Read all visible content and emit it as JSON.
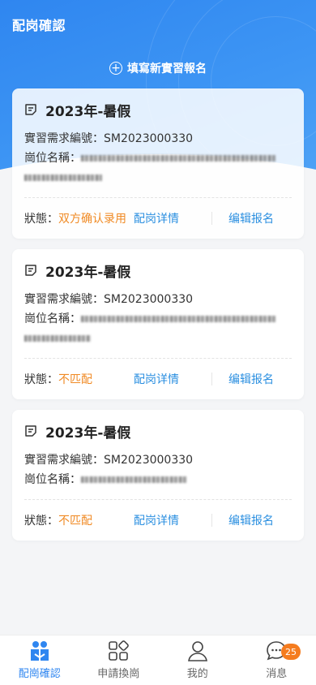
{
  "header": {
    "title": "配岗確認",
    "new_apply_label": "填寫新實習報名"
  },
  "cards": [
    {
      "term": "2023年-暑假",
      "req_label": "實習需求編號：",
      "req_no": "SM2023000330",
      "post_label": "崗位名稱：",
      "status_label": "狀態：",
      "status_value": "双方确认录用",
      "detail_label": "配岗详情",
      "edit_label": "编辑报名"
    },
    {
      "term": "2023年-暑假",
      "req_label": "實習需求編號：",
      "req_no": "SM2023000330",
      "post_label": "崗位名稱：",
      "status_label": "狀態：",
      "status_value": "不匹配",
      "detail_label": "配岗详情",
      "edit_label": "编辑报名"
    },
    {
      "term": "2023年-暑假",
      "req_label": "實習需求編號：",
      "req_no": "SM2023000330",
      "post_label": "崗位名稱：",
      "status_label": "狀態：",
      "status_value": "不匹配",
      "detail_label": "配岗详情",
      "edit_label": "编辑报名"
    }
  ],
  "tabbar": {
    "items": [
      {
        "label": "配崗確認",
        "icon": "people-icon",
        "active": true
      },
      {
        "label": "申請換崗",
        "icon": "apps-icon",
        "active": false
      },
      {
        "label": "我的",
        "icon": "user-icon",
        "active": false
      },
      {
        "label": "消息",
        "icon": "chat-icon",
        "active": false,
        "badge": "25"
      }
    ]
  },
  "colors": {
    "primary": "#2f86f0",
    "status_orange": "#f08a24",
    "link_blue": "#2b8fe0",
    "badge": "#f57c1f"
  }
}
